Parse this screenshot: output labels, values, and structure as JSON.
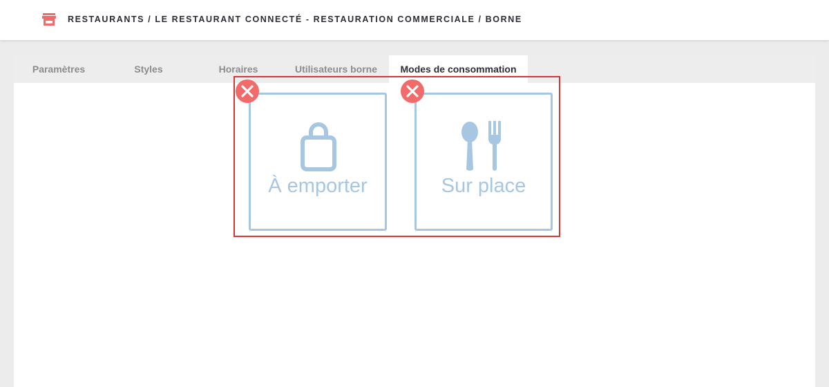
{
  "header": {
    "icon": "store-icon",
    "breadcrumb": "RESTAURANTS / LE RESTAURANT CONNECTÉ - RESTAURATION COMMERCIALE / BORNE"
  },
  "tabs": [
    {
      "label": "Paramètres",
      "active": false
    },
    {
      "label": "Styles",
      "active": false
    },
    {
      "label": "Horaires",
      "active": false
    },
    {
      "label": "Utilisateurs borne",
      "active": false
    },
    {
      "label": "Modes de consommation",
      "active": true
    }
  ],
  "modes": [
    {
      "label": "À emporter",
      "icon": "shopping-bag-icon"
    },
    {
      "label": "Sur place",
      "icon": "spoon-fork-icon"
    }
  ],
  "colors": {
    "accent_red": "#f26b6b",
    "highlight_border": "#d43535",
    "card_blue": "#a7c6e1",
    "tab_bar": "#ededed"
  }
}
